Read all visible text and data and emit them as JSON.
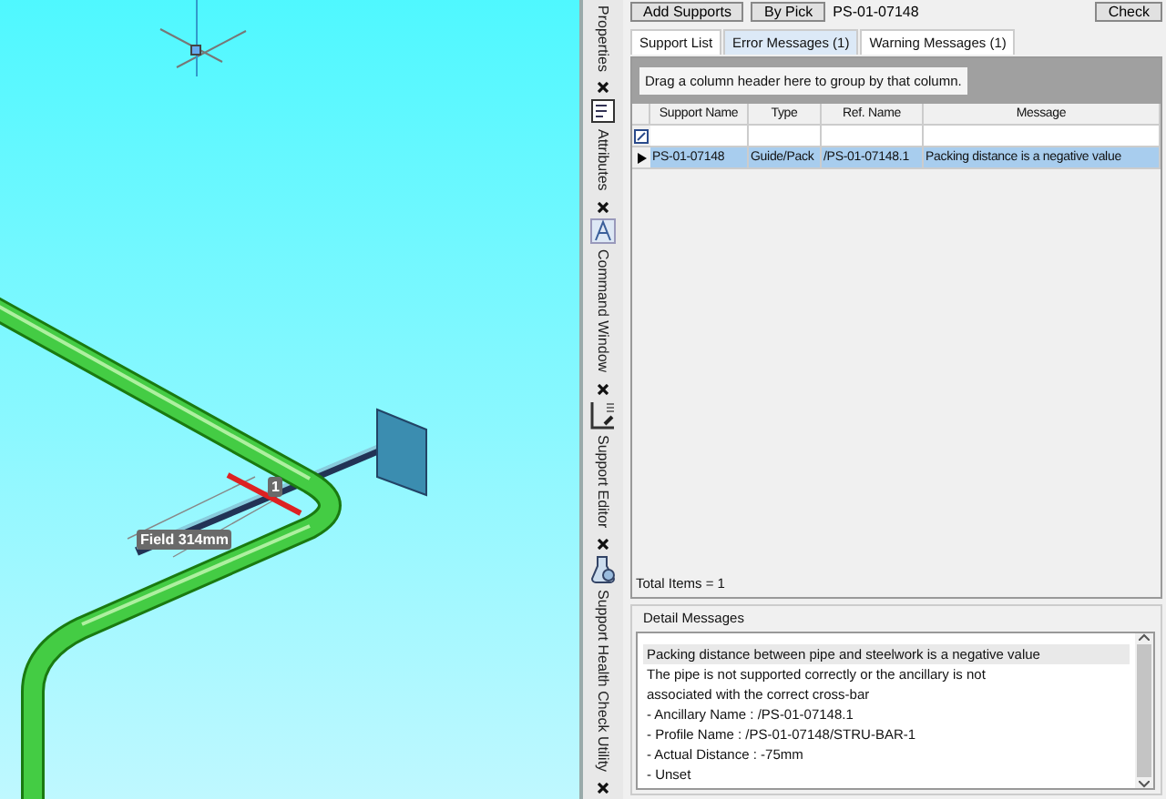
{
  "toolbar": {
    "buttons": [
      "Add Supports",
      "By Pick"
    ],
    "support_field": {
      "value": "PS-01-07148"
    },
    "check_button": "Check"
  },
  "viewport": {
    "dimension_label": "Field 314mm",
    "support_tag": "1"
  },
  "dock_tabs": [
    {
      "label": "Properties"
    },
    {
      "label": "Attributes"
    },
    {
      "label": "Command Window"
    },
    {
      "label": "Support Editor"
    },
    {
      "label": "Support Health Check Utility"
    }
  ],
  "tabs": [
    {
      "label": "Support List",
      "selected": false
    },
    {
      "label": "Error Messages (1)",
      "selected": true
    },
    {
      "label": "Warning Messages (1)",
      "selected": false
    }
  ],
  "grid": {
    "group_hint": "Drag a column header here to group by that column.",
    "columns": [
      "Support Name",
      "Type",
      "Ref. Name",
      "Message"
    ],
    "rows": [
      {
        "cells": [
          "PS-01-07148",
          "Guide/Pack",
          "/PS-01-07148.1",
          "Packing distance is a negative value"
        ],
        "selected": true
      }
    ],
    "footer": "Total Items = 1"
  },
  "detail": {
    "title": "Detail Messages",
    "lines": [
      {
        "text": "Packing distance between pipe and steelwork is a negative value",
        "selected": true
      },
      {
        "text": "The pipe is not supported correctly or the ancillary is not",
        "selected": false
      },
      {
        "text": "associated with the correct cross-bar",
        "selected": false
      },
      {
        "text": "- Ancillary Name : /PS-01-07148.1",
        "selected": false
      },
      {
        "text": "- Profile Name : /PS-01-07148/STRU-BAR-1",
        "selected": false
      },
      {
        "text": "- Actual Distance : -75mm",
        "selected": false
      },
      {
        "text": "- Unset",
        "selected": false
      }
    ]
  }
}
